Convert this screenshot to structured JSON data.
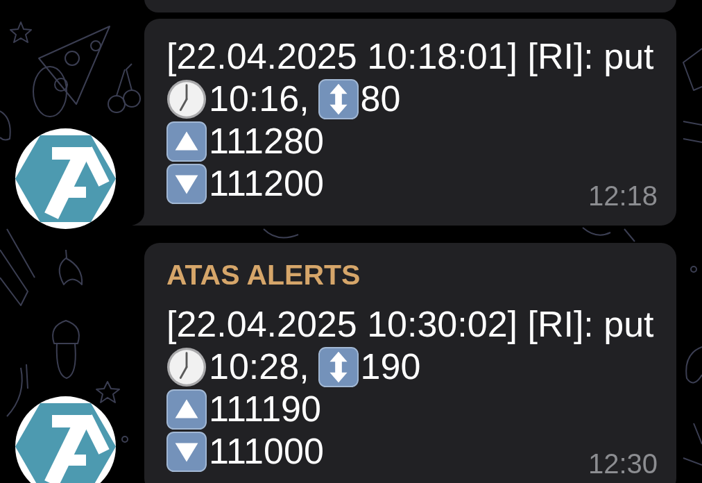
{
  "messages": [
    {
      "kind": "cut_off"
    },
    {
      "kind": "alert",
      "tail": true,
      "alert_text": "[22.04.2025 10:18:01] [RI]: put",
      "clock_time": "10:16,",
      "updown_value": "80",
      "up_value": "111280",
      "down_value": "111200",
      "time": "12:18"
    },
    {
      "kind": "alert",
      "sender": "ATAS ALERTS",
      "alert_text": "[22.04.2025 10:30:02] [RI]: put",
      "clock_time": "10:28,",
      "updown_value": "190",
      "up_value": "111190",
      "down_value": "111000",
      "time": "12:30"
    }
  ]
}
